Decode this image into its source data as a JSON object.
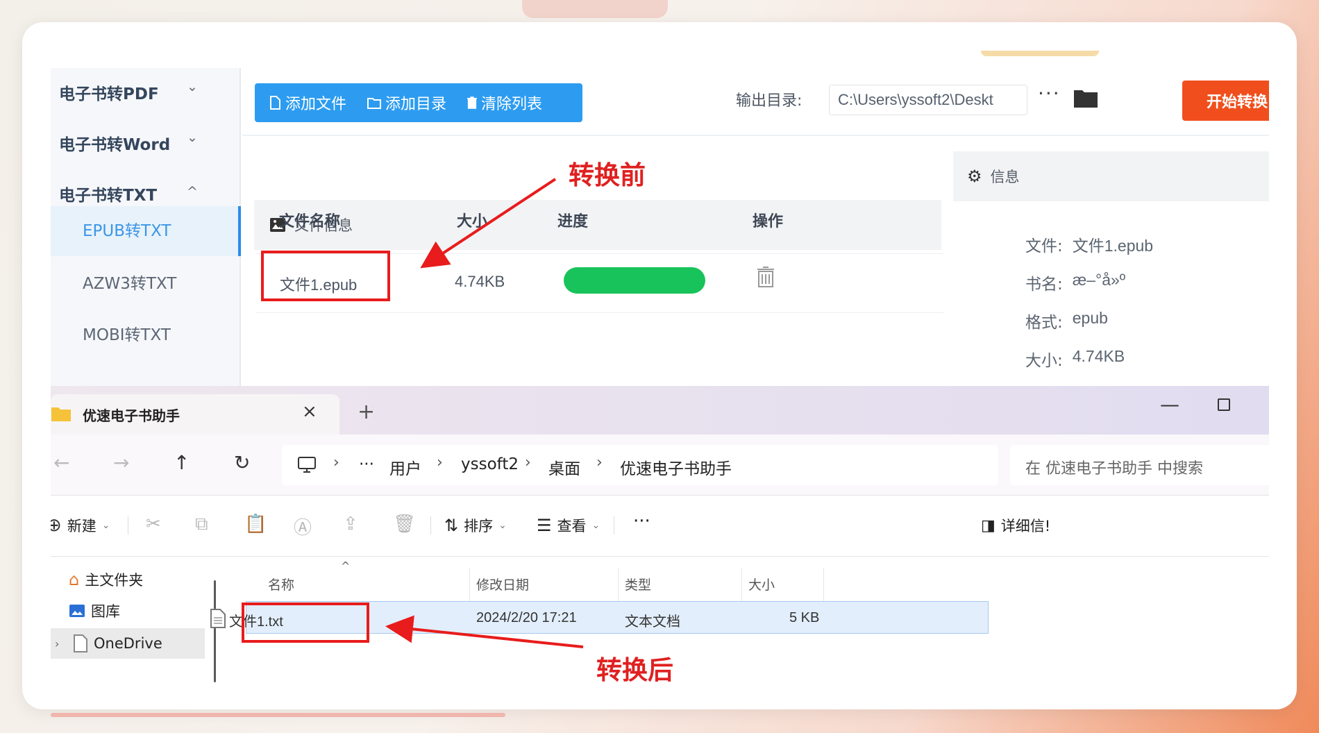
{
  "converter": {
    "sidebar": {
      "groups": [
        {
          "label": "电子书转PDF",
          "chevron": "⌄"
        },
        {
          "label": "电子书转Word",
          "chevron": "⌄"
        },
        {
          "label": "电子书转TXT",
          "chevron": "^"
        }
      ],
      "items": [
        "EPUB转TXT",
        "AZW3转TXT",
        "MOBI转TXT"
      ],
      "active_item": "EPUB转TXT"
    },
    "toolbar": {
      "add_file": "添加文件",
      "add_folder": "添加目录",
      "clear_list": "清除列表",
      "output_label": "输出目录:",
      "output_path": "C:\\Users\\yssoft2\\Deskt",
      "more": "···",
      "start": "开始转换",
      "accent_color": "#2d9cf0",
      "start_color": "#f04f1d"
    },
    "file_panel": {
      "title": "文件信息",
      "columns": [
        "文件名称",
        "大小",
        "进度",
        "操作"
      ],
      "rows": [
        {
          "name": "文件1.epub",
          "size": "4.74KB",
          "progress": 1.0
        }
      ]
    },
    "info_panel": {
      "title": "信息",
      "fields": [
        {
          "label": "文件:",
          "value": "文件1.epub"
        },
        {
          "label": "书名:",
          "value": "æ–°å»º"
        },
        {
          "label": "格式:",
          "value": "epub"
        },
        {
          "label": "大小:",
          "value": "4.74KB"
        }
      ]
    }
  },
  "explorer": {
    "tab_title": "优速电子书助手",
    "close": "×",
    "new_tab": "+",
    "minimize": "—",
    "breadcrumb": {
      "more": "···",
      "parts": [
        "用户",
        "yssoft2",
        "桌面",
        "优速电子书助手"
      ],
      "sep": "›"
    },
    "search_placeholder": "在 优速电子书助手 中搜索",
    "commands": {
      "new": "新建",
      "sort": "排序",
      "view": "查看",
      "more": "···",
      "details": "详细信!"
    },
    "nav": [
      "主文件夹",
      "图库",
      "OneDrive"
    ],
    "columns": [
      "名称",
      "修改日期",
      "类型",
      "大小"
    ],
    "files": [
      {
        "name": "文件1.txt",
        "modified": "2024/2/20 17:21",
        "type": "文本文档",
        "size": "5 KB"
      }
    ]
  },
  "annotations": {
    "before": "转换前",
    "after": "转换后",
    "color": "#e81c1c"
  }
}
